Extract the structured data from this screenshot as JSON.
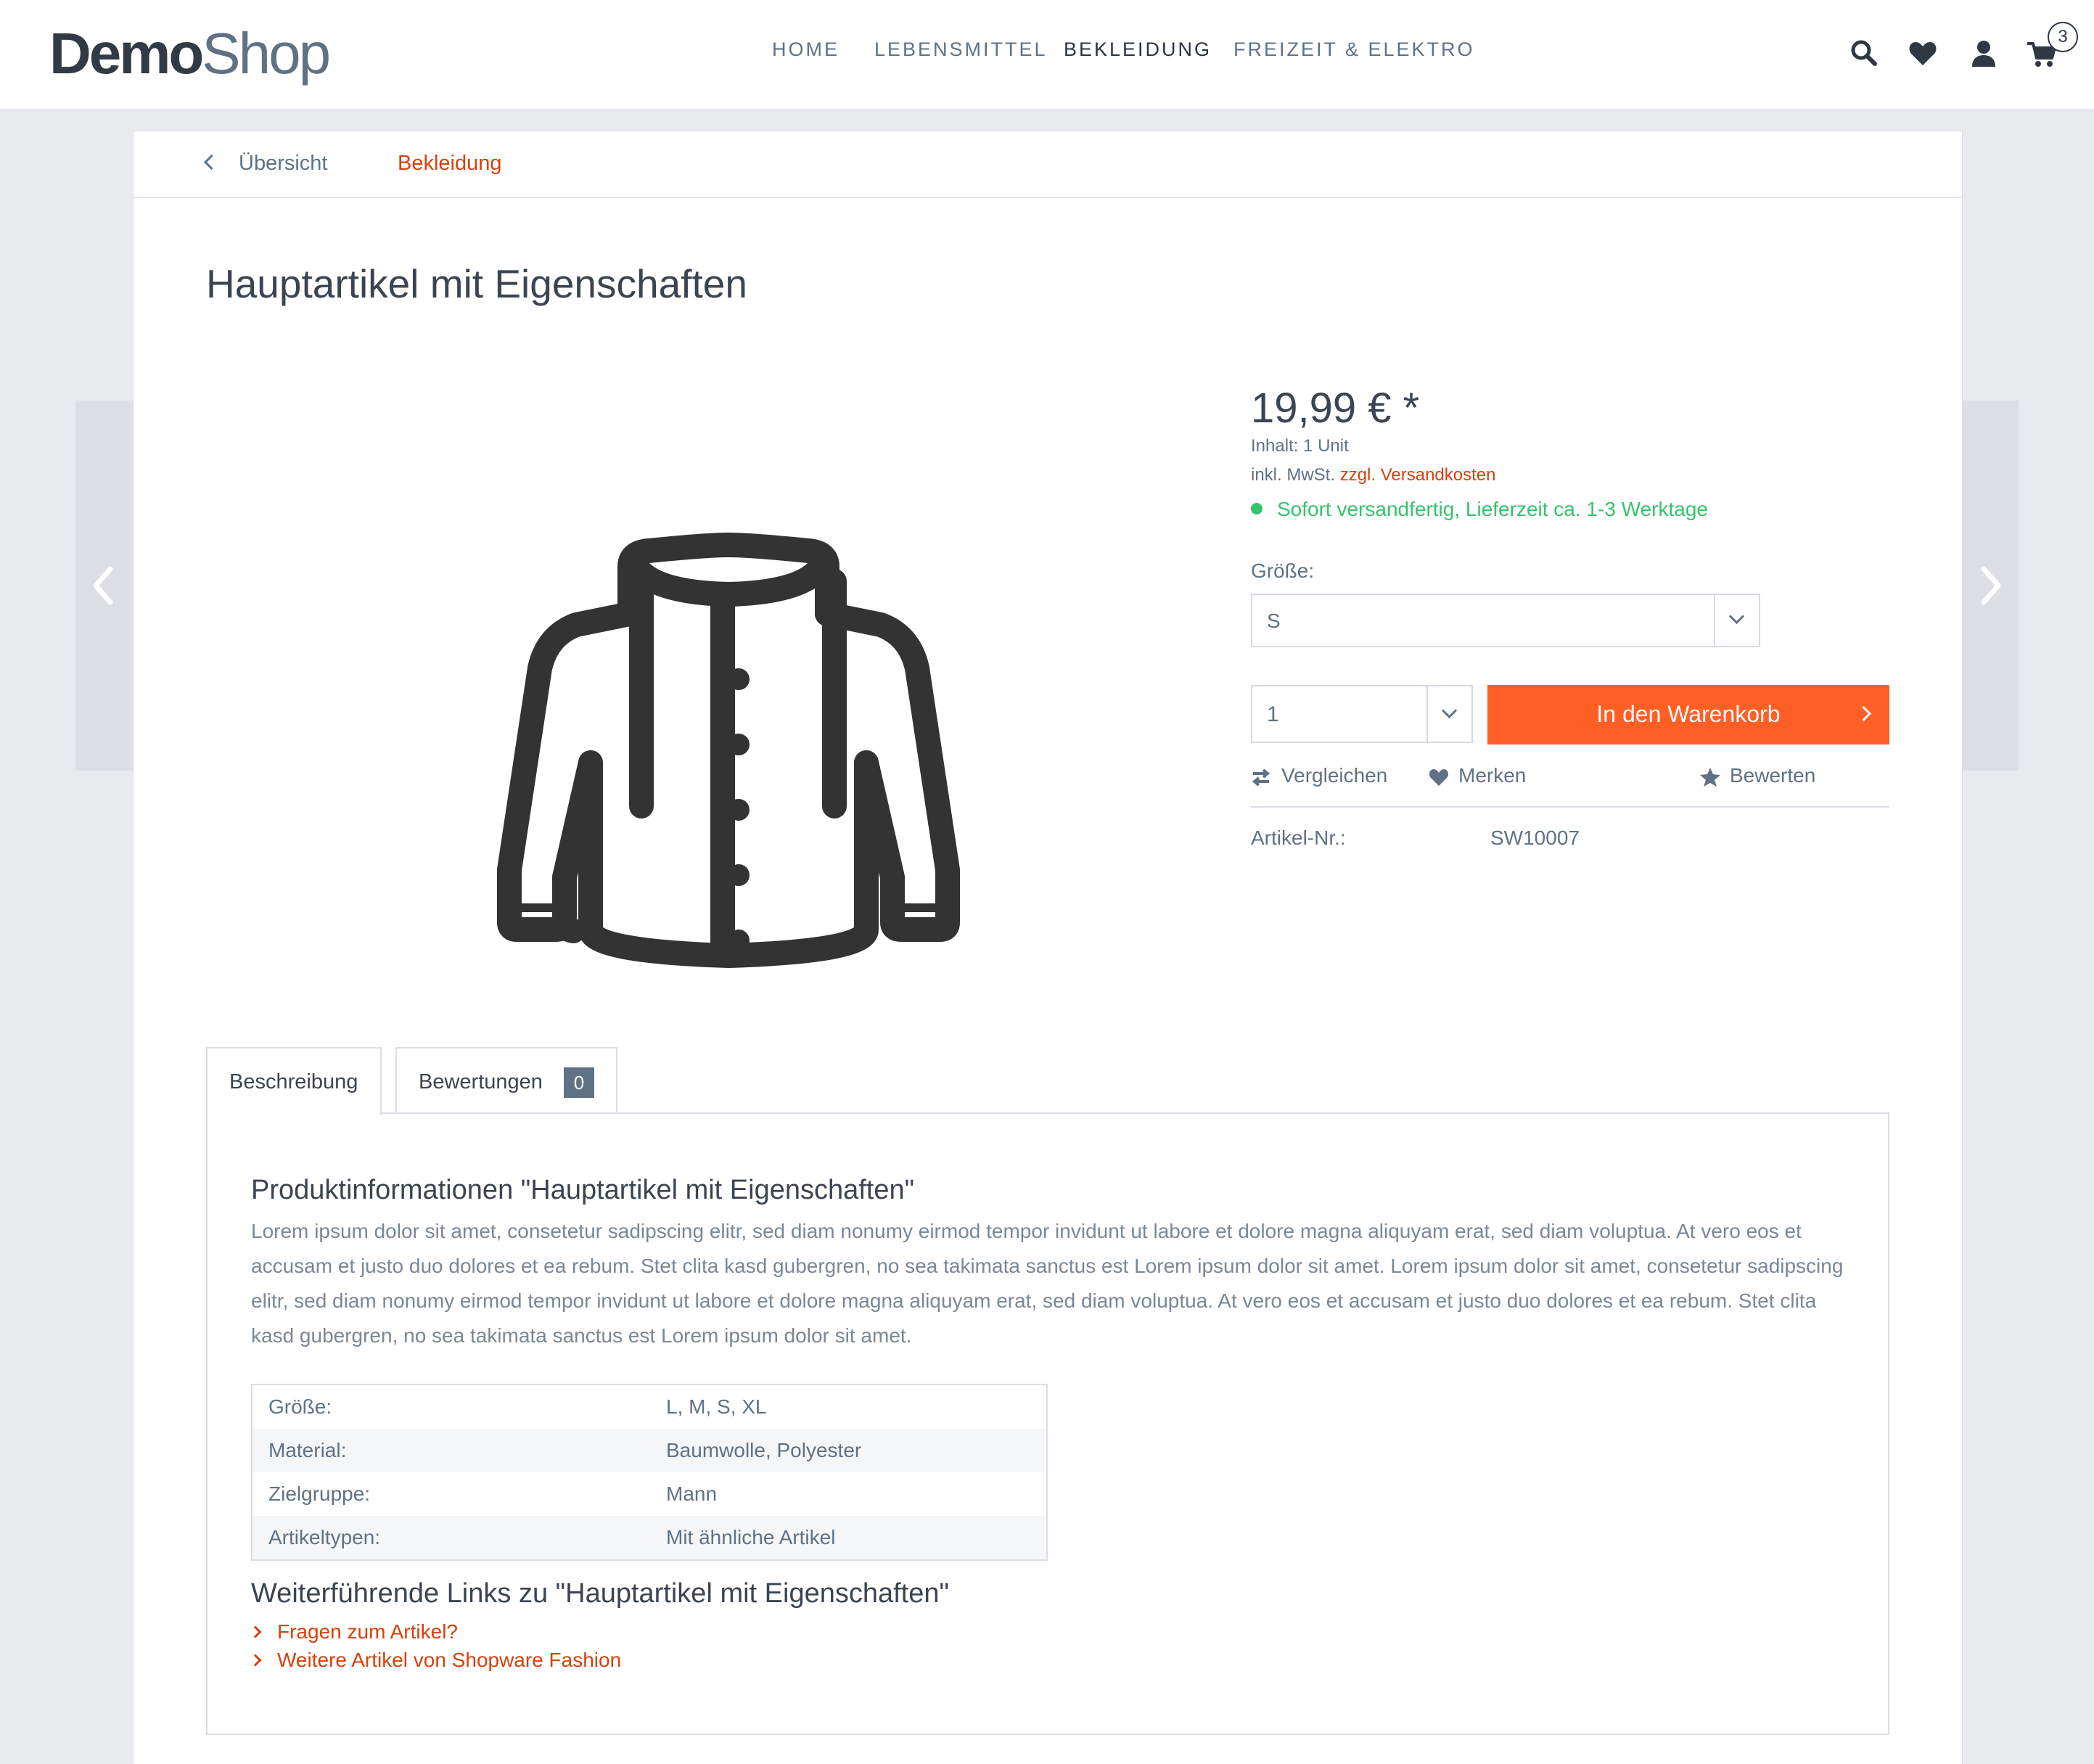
{
  "logo": {
    "part1": "Demo",
    "part2": "Shop"
  },
  "nav": [
    {
      "label": "HOME"
    },
    {
      "label": "LEBENSMITTEL"
    },
    {
      "label": "BEKLEIDUNG"
    },
    {
      "label": "FREIZEIT & ELEKTRO"
    }
  ],
  "header_icons": [
    "search-icon",
    "heart-icon",
    "user-icon",
    "cart-icon"
  ],
  "cart_count": "3",
  "breadcrumb": {
    "back_label": "Übersicht",
    "category": "Bekleidung"
  },
  "product": {
    "title": "Hauptartikel mit Eigenschaften",
    "image_icon": "jacket-icon",
    "price": "19,99 € *",
    "content_unit": "Inhalt: 1 Unit",
    "tax_text": "inkl. MwSt.",
    "shipping_link": "zzgl. Versandkosten",
    "delivery": "Sofort versandfertig, Lieferzeit ca. 1-3 Werktage",
    "size_label": "Größe:",
    "size_selected": "S",
    "quantity": "1",
    "add_to_cart": "In den Warenkorb",
    "actions": {
      "compare": "Vergleichen",
      "remember": "Merken",
      "rate": "Bewerten"
    },
    "article_number_label": "Artikel-Nr.:",
    "article_number": "SW10007"
  },
  "tabs": {
    "description": "Beschreibung",
    "reviews": "Bewertungen",
    "reviews_count": "0"
  },
  "description": {
    "title": "Produktinformationen \"Hauptartikel mit Eigenschaften\"",
    "text": "Lorem ipsum dolor sit amet, consetetur sadipscing elitr, sed diam nonumy eirmod tempor invidunt ut labore et dolore magna aliquyam erat, sed diam voluptua. At vero eos et accusam et justo duo dolores et ea rebum. Stet clita kasd gubergren, no sea takimata sanctus est Lorem ipsum dolor sit amet. Lorem ipsum dolor sit amet, consetetur sadipscing elitr, sed diam nonumy eirmod tempor invidunt ut labore et dolore magna aliquyam erat, sed diam voluptua. At vero eos et accusam et justo duo dolores et ea rebum. Stet clita kasd gubergren, no sea takimata sanctus est Lorem ipsum dolor sit amet.",
    "properties": [
      {
        "key": "Größe:",
        "value": "L, M, S, XL"
      },
      {
        "key": "Material:",
        "value": "Baumwolle, Polyester"
      },
      {
        "key": "Zielgruppe:",
        "value": "Mann"
      },
      {
        "key": "Artikeltypen:",
        "value": "Mit ähnliche Artikel"
      }
    ],
    "links_title": "Weiterführende Links zu \"Hauptartikel mit Eigenschaften\"",
    "links": [
      {
        "label": "Fragen zum Artikel?"
      },
      {
        "label": "Weitere Artikel von Shopware Fashion"
      }
    ]
  },
  "colors": {
    "accent": "#ff5f24",
    "link": "#d9400b",
    "available": "#35c36b",
    "text": "#5f7285"
  }
}
